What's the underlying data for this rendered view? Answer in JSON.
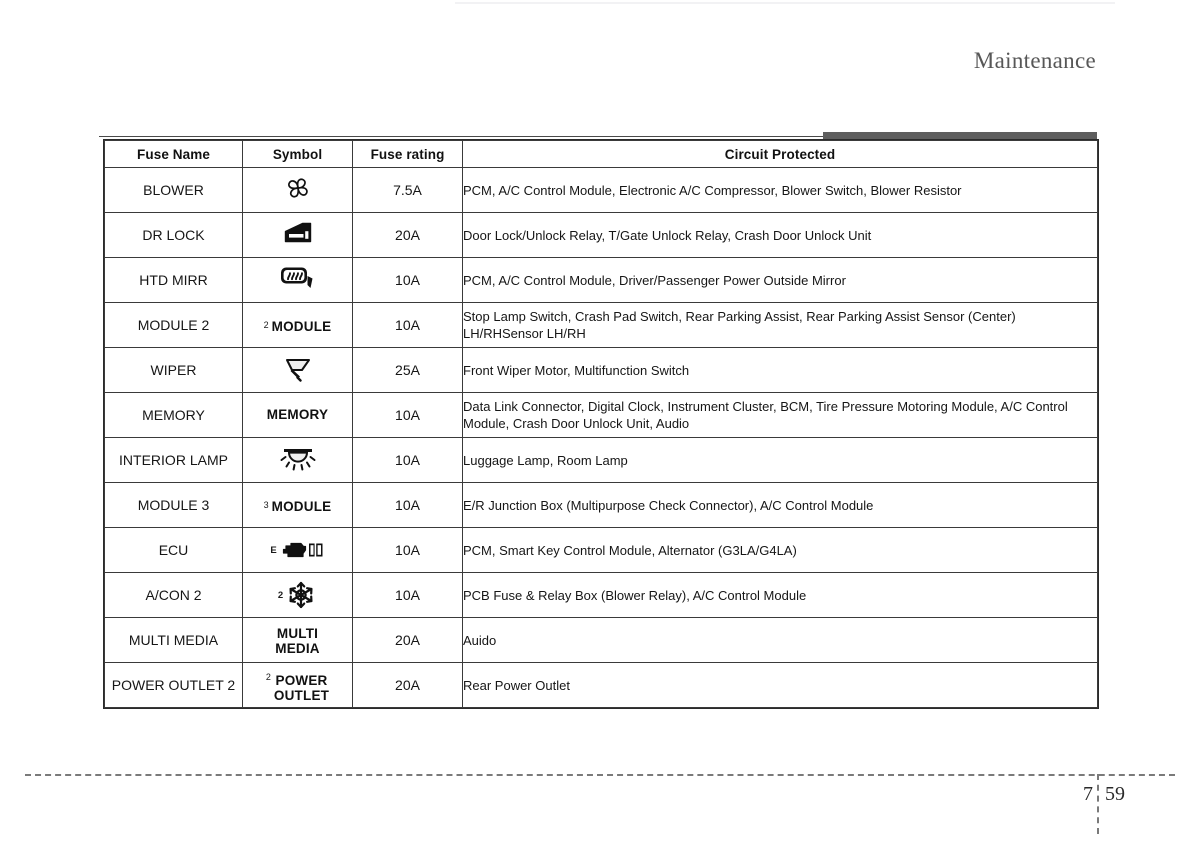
{
  "header": {
    "title": "Maintenance"
  },
  "footer": {
    "chapter": "7",
    "page": "59"
  },
  "table": {
    "columns": [
      "Fuse Name",
      "Symbol",
      "Fuse rating",
      "Circuit Protected"
    ],
    "rows": [
      {
        "fuse_name": "BLOWER",
        "symbol_kind": "fan-icon",
        "symbol_text": "",
        "symbol_sup": "",
        "fuse_rating": "7.5A",
        "circuit_protected": "PCM, A/C Control Module, Electronic A/C Compressor, Blower Switch, Blower Resistor"
      },
      {
        "fuse_name": "DR LOCK",
        "symbol_kind": "door-lock-icon",
        "symbol_text": "",
        "symbol_sup": "",
        "fuse_rating": "20A",
        "circuit_protected": "Door Lock/Unlock Relay, T/Gate Unlock Relay, Crash Door Unlock Unit"
      },
      {
        "fuse_name": "HTD MIRR",
        "symbol_kind": "heated-mirror-icon",
        "symbol_text": "",
        "symbol_sup": "",
        "fuse_rating": "10A",
        "circuit_protected": "PCM, A/C Control Module, Driver/Passenger Power Outside Mirror"
      },
      {
        "fuse_name": "MODULE 2",
        "symbol_kind": "text-label",
        "symbol_text": "MODULE",
        "symbol_sup": "2",
        "fuse_rating": "10A",
        "circuit_protected": "Stop Lamp Switch, Crash Pad Switch, Rear Parking Assist, Rear Parking Assist Sensor (Center) LH/RHSensor LH/RH"
      },
      {
        "fuse_name": "WIPER",
        "symbol_kind": "wiper-icon",
        "symbol_text": "",
        "symbol_sup": "",
        "fuse_rating": "25A",
        "circuit_protected": "Front Wiper Motor, Multifunction Switch"
      },
      {
        "fuse_name": "MEMORY",
        "symbol_kind": "text-label",
        "symbol_text": "MEMORY",
        "symbol_sup": "",
        "fuse_rating": "10A",
        "circuit_protected": "Data Link Connector, Digital Clock, Instrument Cluster, BCM, Tire Pressure Motoring Module, A/C Control Module, Crash Door Unlock Unit, Audio"
      },
      {
        "fuse_name": "INTERIOR LAMP",
        "symbol_kind": "dome-lamp-icon",
        "symbol_text": "",
        "symbol_sup": "",
        "fuse_rating": "10A",
        "circuit_protected": "Luggage Lamp, Room Lamp"
      },
      {
        "fuse_name": "MODULE 3",
        "symbol_kind": "text-label",
        "symbol_text": "MODULE",
        "symbol_sup": "3",
        "fuse_rating": "10A",
        "circuit_protected": "E/R Junction Box (Multipurpose Check Connector), A/C Control Module"
      },
      {
        "fuse_name": "ECU",
        "symbol_kind": "engine-manual-icon",
        "symbol_text": "",
        "symbol_sup": "E",
        "fuse_rating": "10A",
        "circuit_protected": "PCM, Smart Key Control Module, Alternator (G3LA/G4LA)"
      },
      {
        "fuse_name": "A/CON 2",
        "symbol_kind": "snowflake-icon",
        "symbol_text": "",
        "symbol_sup": "2",
        "fuse_rating": "10A",
        "circuit_protected": "PCB Fuse & Relay Box (Blower Relay), A/C Control Module"
      },
      {
        "fuse_name": "MULTI MEDIA",
        "symbol_kind": "text-label-2line",
        "symbol_text": "MULTI\nMEDIA",
        "symbol_sup": "",
        "fuse_rating": "20A",
        "circuit_protected": "Auido"
      },
      {
        "fuse_name": "POWER OUTLET 2",
        "symbol_kind": "text-label-2line",
        "symbol_text": "POWER\nOUTLET",
        "symbol_sup": "2",
        "fuse_rating": "20A",
        "circuit_protected": "Rear Power Outlet"
      }
    ]
  },
  "colors": {
    "rule": "#4a4a4a",
    "header_bar": "#5e5e5e",
    "table_border": "#3a3a3a",
    "text": "#161616"
  }
}
